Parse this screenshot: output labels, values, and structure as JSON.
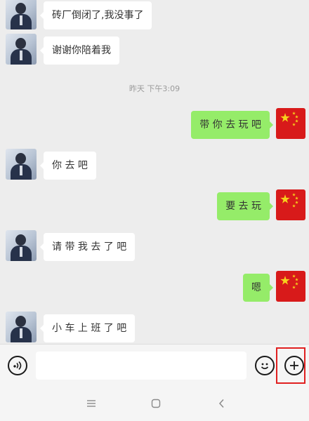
{
  "chat": {
    "messages": [
      {
        "side": "in",
        "text": "砖厂倒闭了,我没事了"
      },
      {
        "side": "in",
        "text": "谢谢你陪着我"
      },
      {
        "side": "out",
        "text": "带 你 去 玩 吧"
      },
      {
        "side": "in",
        "text": "你 去 吧"
      },
      {
        "side": "out",
        "text": "要 去 玩"
      },
      {
        "side": "in",
        "text": "请 带 我 去 了 吧"
      },
      {
        "side": "out",
        "text": "嗯"
      },
      {
        "side": "in",
        "text": "小 车 上 班 了 吧"
      }
    ],
    "timestamp": "昨天 下午3:09"
  },
  "input_bar": {
    "voice_icon": "voice-icon",
    "input_value": "",
    "input_placeholder": "",
    "emoji_icon": "emoji-icon",
    "plus_icon": "plus-icon"
  },
  "nav_bar": {
    "menu_icon": "menu-icon",
    "home_icon": "home-icon",
    "back_icon": "back-icon"
  },
  "colors": {
    "bubble_outgoing": "#95ec69",
    "bubble_incoming": "#ffffff",
    "chat_background": "#ededed",
    "highlight": "#e02020"
  }
}
